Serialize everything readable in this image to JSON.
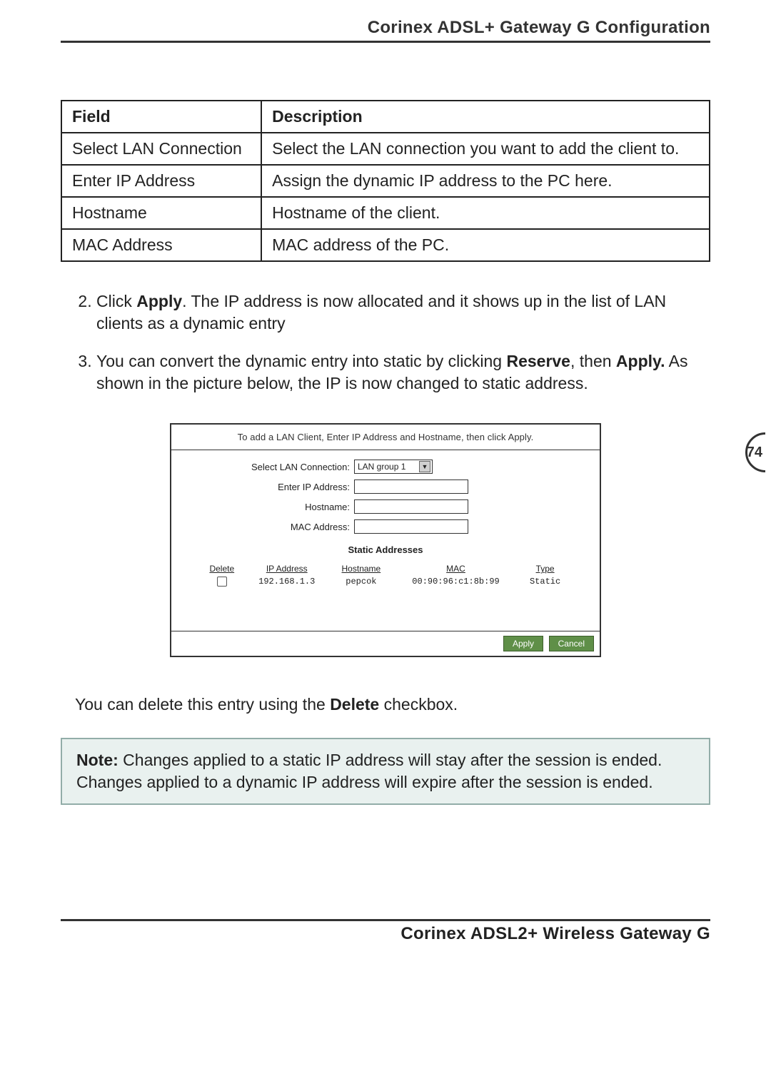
{
  "header": {
    "title": "Corinex ADSL+ Gateway G Configuration"
  },
  "field_table": {
    "head": {
      "field": "Field",
      "description": "Description"
    },
    "rows": [
      {
        "field": "Select LAN Connection",
        "desc": "Select the LAN connection you want to add the client to."
      },
      {
        "field": "Enter IP Address",
        "desc": "Assign the dynamic IP address to the PC here."
      },
      {
        "field": "Hostname",
        "desc": "Hostname of the client."
      },
      {
        "field": "MAC Address",
        "desc": "MAC address of the PC."
      }
    ]
  },
  "steps": {
    "s2": {
      "prefix": "Click ",
      "bold1": "Apply",
      "rest": ". The IP address is now allocated and it shows up in the list of LAN clients as a dynamic entry"
    },
    "s3": {
      "prefix": "You can convert the dynamic entry into static by clicking ",
      "bold1": "Reserve",
      "mid": ", then ",
      "bold2": "Apply.",
      "rest": " As shown in the picture below, the IP is now changed to static address."
    }
  },
  "screenshot": {
    "title": "To add a LAN Client, Enter IP Address and Hostname, then click Apply.",
    "labels": {
      "select_lan": "Select LAN Connection:",
      "enter_ip": "Enter IP Address:",
      "hostname": "Hostname:",
      "mac": "MAC Address:"
    },
    "select_value": "LAN group 1",
    "static_head": "Static Addresses",
    "table_head": {
      "delete": "Delete",
      "ip": "IP Address",
      "host": "Hostname",
      "mac": "MAC",
      "type": "Type"
    },
    "table_row": {
      "ip": "192.168.1.3",
      "host": "pepcok",
      "mac": "00:90:96:c1:8b:99",
      "type": "Static"
    },
    "buttons": {
      "apply": "Apply",
      "cancel": "Cancel"
    }
  },
  "body_text": {
    "pre": "You can delete this entry using the ",
    "bold": "Delete",
    "post": " checkbox."
  },
  "note": {
    "label": "Note:",
    "text": " Changes applied to a static IP address will stay after the session is ended. Changes applied to a dynamic IP address will expire after the session is ended."
  },
  "footer": {
    "title": "Corinex ADSL2+ Wireless Gateway G"
  },
  "page_number": "74"
}
